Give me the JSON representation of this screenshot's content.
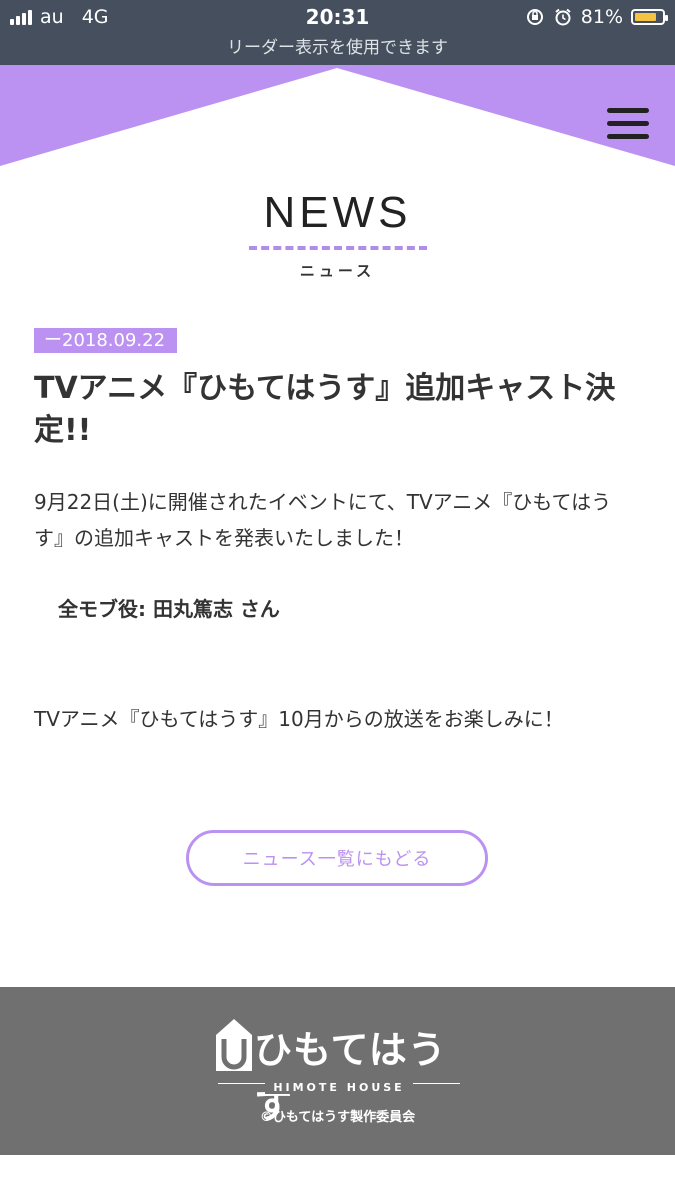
{
  "status_bar": {
    "carrier": "au",
    "network": "4G",
    "time": "20:31",
    "battery_text": "81%",
    "battery_level": 0.81,
    "reader_notice": "リーダー表示を使用できます"
  },
  "colors": {
    "accent": "#bb92f1",
    "status_bar_bg": "#454f5d",
    "footer_bg": "#707070",
    "text": "#333333"
  },
  "header": {
    "menu_icon": "hamburger-menu-icon"
  },
  "news": {
    "title": "NEWS",
    "subtitle": "ニュース"
  },
  "article": {
    "date": "ー2018.09.22",
    "title": "TVアニメ『ひもてはうす』追加キャスト決定!!",
    "body": "9月22日(土)に開催されたイベントにて、TVアニメ『ひもてはうす』の追加キャストを発表いたしました！",
    "cast": "全モブ役: 田丸篤志 さん",
    "closing": "TVアニメ『ひもてはうす』10月からの放送をお楽しみに！"
  },
  "back_button_label": "ニュース一覧にもどる",
  "footer": {
    "logo_text": "ひもてはうす",
    "logo_sub": "HIMOTE HOUSE",
    "copyright": "©ひもてはうす製作委員会"
  }
}
